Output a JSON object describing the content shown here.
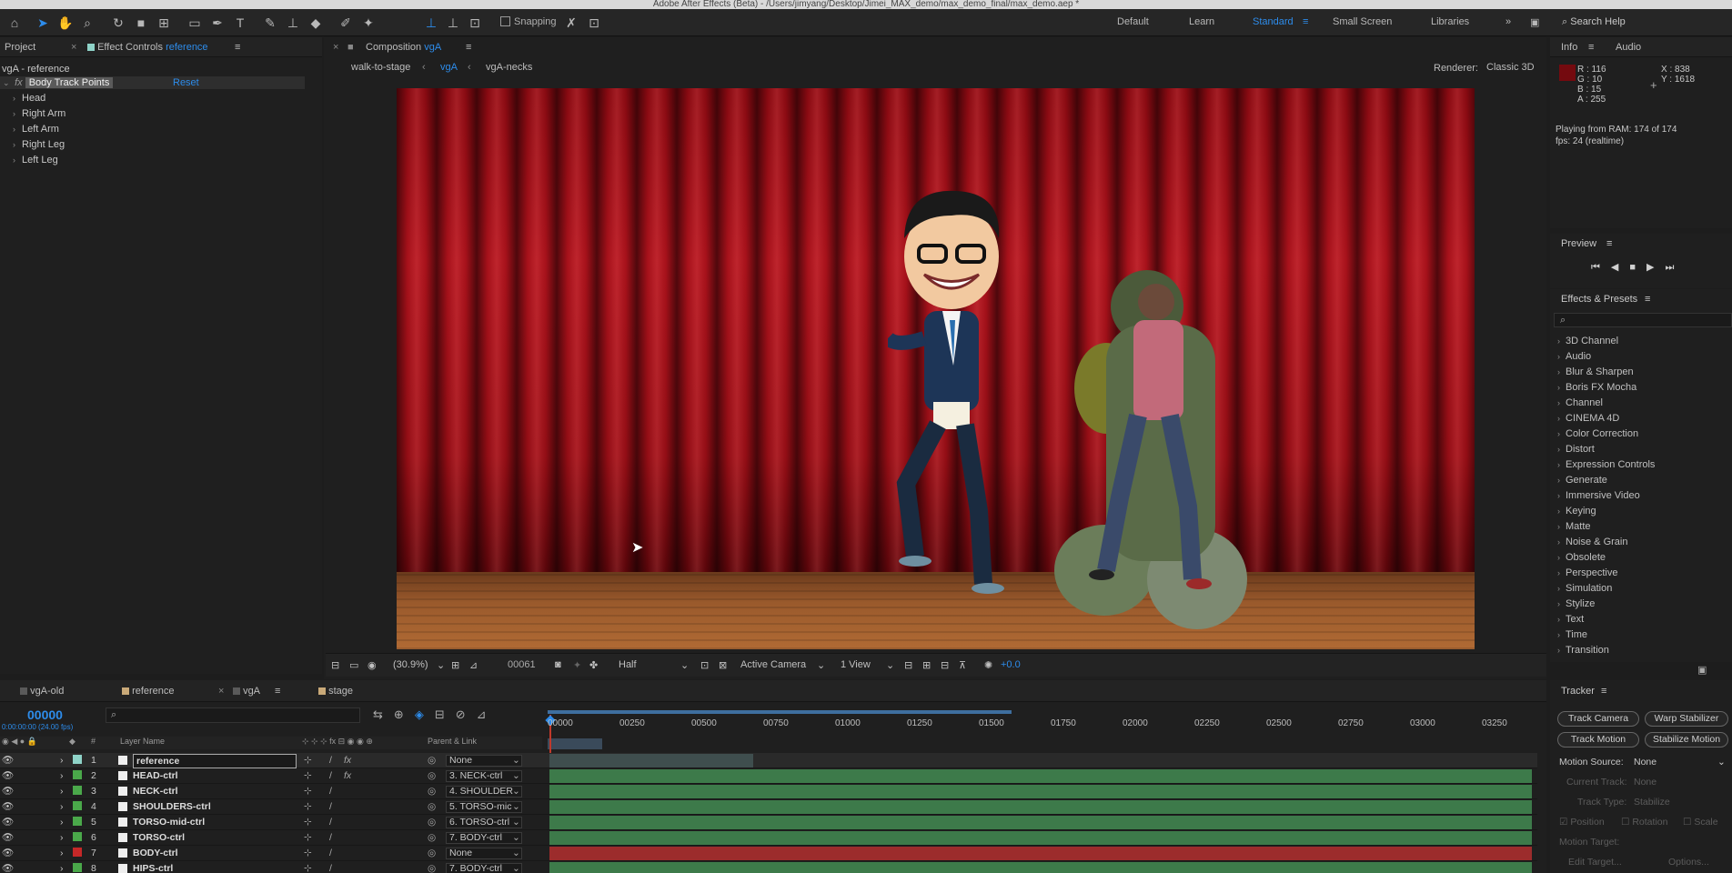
{
  "app": {
    "title": "Adobe After Effects (Beta) - /Users/jimyang/Desktop/Jimei_MAX_demo/max_demo_final/max_demo.aep *"
  },
  "toolbar": {
    "snapping_label": "Snapping",
    "workspaces": [
      "Default",
      "Learn",
      "Standard",
      "Small Screen",
      "Libraries"
    ],
    "active_workspace": "Standard",
    "search_help": "Search Help"
  },
  "project_panel": {
    "tab_project": "Project",
    "tab_effect_controls": "Effect Controls",
    "effect_controls_layer": "reference",
    "layer_path": "vgA - reference",
    "effect_name": "Body Track Points",
    "reset_label": "Reset",
    "groups": [
      "Head",
      "Right Arm",
      "Left Arm",
      "Right Leg",
      "Left Leg"
    ]
  },
  "composition": {
    "tab_label": "Composition",
    "tab_comp": "vgA",
    "breadcrumbs": [
      "walk-to-stage",
      "vgA",
      "vgA-necks"
    ],
    "active_breadcrumb": "vgA",
    "renderer_label": "Renderer:",
    "renderer_value": "Classic 3D",
    "zoom": "(30.9%)",
    "frame": "00061",
    "resolution": "Half",
    "camera": "Active Camera",
    "views": "1 View",
    "exposure": "+0.0"
  },
  "info_panel": {
    "tab_info": "Info",
    "tab_audio": "Audio",
    "r": "R : 116",
    "g": "G : 10",
    "b": "B : 15",
    "a": "A : 255",
    "x": "X : 838",
    "y": "Y : 1618",
    "color": "#740a0f",
    "playing": "Playing from RAM: 174 of 174",
    "fps": "fps: 24 (realtime)"
  },
  "preview_panel": {
    "title": "Preview"
  },
  "effects_presets": {
    "title": "Effects & Presets",
    "items": [
      "3D Channel",
      "Audio",
      "Blur & Sharpen",
      "Boris FX Mocha",
      "Channel",
      "CINEMA 4D",
      "Color Correction",
      "Distort",
      "Expression Controls",
      "Generate",
      "Immersive Video",
      "Keying",
      "Matte",
      "Noise & Grain",
      "Obsolete",
      "Perspective",
      "Simulation",
      "Stylize",
      "Text",
      "Time",
      "Transition"
    ]
  },
  "timeline": {
    "tabs": [
      {
        "label": "vgA-old",
        "color": "#5a5a5a"
      },
      {
        "label": "reference",
        "color": "#c9a978"
      },
      {
        "label": "vgA",
        "color": "#5a5a5a"
      },
      {
        "label": "stage",
        "color": "#c9a978"
      }
    ],
    "active_tab": "vgA",
    "timecode": "00000",
    "timecode_sub": "0:00:00:00 (24.00 fps)",
    "col_layer_name": "Layer Name",
    "col_parent": "Parent & Link",
    "ruler": [
      "00000",
      "00250",
      "00500",
      "00750",
      "01000",
      "01250",
      "01500",
      "01750",
      "02000",
      "02250",
      "02500",
      "02750",
      "03000",
      "03250"
    ],
    "layers": [
      {
        "num": "1",
        "name": "reference",
        "color": "#8fd3c8",
        "parent": "None",
        "bar": "#3f4e4e"
      },
      {
        "num": "2",
        "name": "HEAD-ctrl",
        "color": "#4aa84a",
        "parent": "3. NECK-ctrl",
        "bar": "#3d7a4a"
      },
      {
        "num": "3",
        "name": "NECK-ctrl",
        "color": "#4aa84a",
        "parent": "4. SHOULDER",
        "bar": "#3d7a4a"
      },
      {
        "num": "4",
        "name": "SHOULDERS-ctrl",
        "color": "#4aa84a",
        "parent": "5. TORSO-mic",
        "bar": "#3d7a4a"
      },
      {
        "num": "5",
        "name": "TORSO-mid-ctrl",
        "color": "#4aa84a",
        "parent": "6. TORSO-ctrl",
        "bar": "#3d7a4a"
      },
      {
        "num": "6",
        "name": "TORSO-ctrl",
        "color": "#4aa84a",
        "parent": "7. BODY-ctrl",
        "bar": "#3d7a4a"
      },
      {
        "num": "7",
        "name": "BODY-ctrl",
        "color": "#c62828",
        "parent": "None",
        "bar": "#9c2c2c"
      },
      {
        "num": "8",
        "name": "HIPS-ctrl",
        "color": "#4aa84a",
        "parent": "7. BODY-ctrl",
        "bar": "#3d7a4a"
      }
    ]
  },
  "tracker": {
    "title": "Tracker",
    "btn_track_camera": "Track Camera",
    "btn_warp_stabilizer": "Warp Stabilizer",
    "btn_track_motion": "Track Motion",
    "btn_stabilize_motion": "Stabilize Motion",
    "motion_source_label": "Motion Source:",
    "motion_source_value": "None",
    "current_track_label": "Current Track:",
    "current_track_value": "None",
    "track_type_label": "Track Type:",
    "track_type_value": "Stabilize",
    "opt_position": "Position",
    "opt_rotation": "Rotation",
    "opt_scale": "Scale",
    "motion_target_label": "Motion Target:",
    "edit_target": "Edit Target...",
    "options": "Options..."
  }
}
